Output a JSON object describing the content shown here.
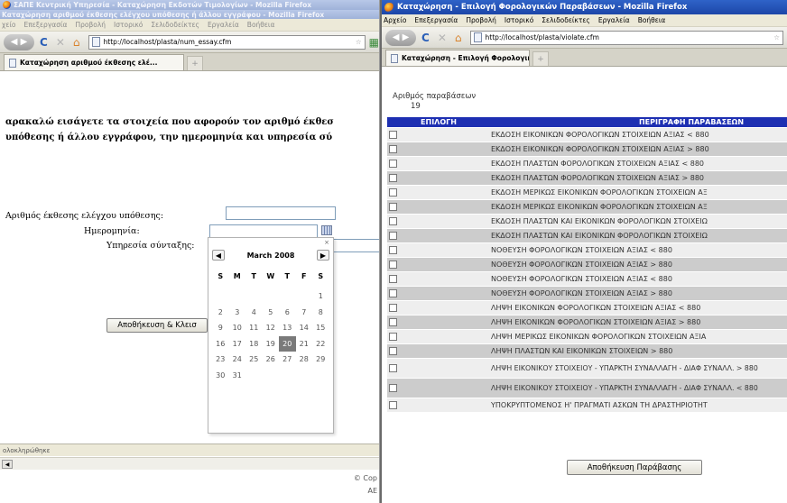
{
  "left_window": {
    "title": "ΣΑΠΕ Κεντρική Υπηρεσία - Καταχώρηση Εκδοτών Τιμολογίων - Mozilla Firefox",
    "title_line2": "Καταχώρηση αριθμού έκθεσης ελέγχου υπόθεσης ή άλλου εγγράφου - Mozilla Firefox",
    "menu": [
      "χείο",
      "Επεξεργασία",
      "Προβολή",
      "Ιστορικό",
      "Σελιδοδείκτες",
      "Εργαλεία",
      "Βοήθεια"
    ],
    "url": "http://localhost/plasta/num_essay.cfm",
    "tab_title": "Καταχώρηση αριθμού έκθεσης ελέ...",
    "instruction_line1": "αρακαλώ εισάγετε τα στοιχεία που αφορούν τον αριθμό έκθεσ",
    "instruction_line2": "υπόθεσης ή άλλου εγγράφου, την ημερομηνία και υπηρεσία σύ",
    "field_report_label": "Αριθμός έκθεσης ελέγχου υπόθεσης:",
    "field_date_label": "Ημερομηνία:",
    "field_service_label": "Υπηρεσία σύνταξης:",
    "save_button": "Αποθήκευση & Κλεισ",
    "status": "ολοκληρώθηκε",
    "copyright_line1": "© Cop",
    "copyright_line2": "ΑΕ",
    "calendar": {
      "close": "×",
      "prev": "◀",
      "next": "▶",
      "month": "March 2008",
      "dow": [
        "S",
        "M",
        "T",
        "W",
        "T",
        "F",
        "S"
      ],
      "days": [
        "",
        "",
        "",
        "",
        "",
        "",
        "1",
        "2",
        "3",
        "4",
        "5",
        "6",
        "7",
        "8",
        "9",
        "10",
        "11",
        "12",
        "13",
        "14",
        "15",
        "16",
        "17",
        "18",
        "19",
        "20",
        "21",
        "22",
        "23",
        "24",
        "25",
        "26",
        "27",
        "28",
        "29",
        "30",
        "31"
      ],
      "selected": "20"
    }
  },
  "right_window": {
    "title": "Καταχώρηση - Επιλογή Φορολογικών Παραβάσεων - Mozilla Firefox",
    "menu": [
      "Αρχείο",
      "Επεξεργασία",
      "Προβολή",
      "Ιστορικό",
      "Σελιδοδείκτες",
      "Εργαλεία",
      "Βοήθεια"
    ],
    "url": "http://localhost/plasta/violate.cfm",
    "tab_title": "Καταχώρηση - Επιλογή Φορολογικώ...",
    "new_tab": "+",
    "count_label": "Αριθμός παραβάσεων",
    "count_value": "19",
    "table": {
      "headers": [
        "ΕΠΙΛΟΓΗ",
        "ΠΕΡΙΓΡΑΦΗ ΠΑΡΑΒΑΣΕΩΝ"
      ],
      "rows": [
        "ΕΚΔΟΣΗ ΕΙΚΟΝΙΚΩΝ ΦΟΡΟΛΟΓΙΚΩΝ ΣΤΟΙΧΕΙΩΝ ΑΞΙΑΣ < 880",
        "ΕΚΔΟΣΗ ΕΙΚΟΝΙΚΩΝ ΦΟΡΟΛΟΓΙΚΩΝ ΣΤΟΙΧΕΙΩΝ ΑΞΙΑΣ > 880",
        "ΕΚΔΟΣΗ ΠΛΑΣΤΩΝ ΦΟΡΟΛΟΓΙΚΩΝ ΣΤΟΙΧΕΙΩΝ ΑΞΙΑΣ < 880",
        "ΕΚΔΟΣΗ ΠΛΑΣΤΩΝ ΦΟΡΟΛΟΓΙΚΩΝ ΣΤΟΙΧΕΙΩΝ ΑΞΙΑΣ > 880",
        "ΕΚΔΟΣΗ ΜΕΡΙΚΩΣ ΕΙΚΟΝΙΚΩΝ ΦΟΡΟΛΟΓΙΚΩΝ ΣΤΟΙΧΕΙΩΝ ΑΞ",
        "ΕΚΔΟΣΗ ΜΕΡΙΚΩΣ ΕΙΚΟΝΙΚΩΝ ΦΟΡΟΛΟΓΙΚΩΝ ΣΤΟΙΧΕΙΩΝ ΑΞ",
        "ΕΚΔΟΣΗ ΠΛΑΣΤΩΝ ΚΑΙ ΕΙΚΟΝΙΚΩΝ ΦΟΡΟΛΟΓΙΚΩΝ ΣΤΟΙΧΕΙΩ",
        "ΕΚΔΟΣΗ ΠΛΑΣΤΩΝ ΚΑΙ ΕΙΚΟΝΙΚΩΝ ΦΟΡΟΛΟΓΙΚΩΝ ΣΤΟΙΧΕΙΩ",
        "ΝΟΘΕΥΣΗ ΦΟΡΟΛΟΓΙΚΩΝ ΣΤΟΙΧΕΙΩΝ ΑΞΙΑΣ < 880",
        "ΝΟΘΕΥΣΗ ΦΟΡΟΛΟΓΙΚΩΝ ΣΤΟΙΧΕΙΩΝ ΑΞΙΑΣ > 880",
        "ΝΟΘΕΥΣΗ ΦΟΡΟΛΟΓΙΚΩΝ ΣΤΟΙΧΕΙΩΝ ΑΞΙΑΣ < 880",
        "ΝΟΘΕΥΣΗ ΦΟΡΟΛΟΓΙΚΩΝ ΣΤΟΙΧΕΙΩΝ ΑΞΙΑΣ > 880",
        "ΛΗΨΗ ΕΙΚΟΝΙΚΩΝ ΦΟΡΟΛΟΓΙΚΩΝ ΣΤΟΙΧΕΙΩΝ ΑΞΙΑΣ < 880",
        "ΛΗΨΗ ΕΙΚΟΝΙΚΩΝ ΦΟΡΟΛΟΓΙΚΩΝ ΣΤΟΙΧΕΙΩΝ ΑΞΙΑΣ > 880",
        "ΛΗΨΗ ΜΕΡΙΚΩΣ ΕΙΚΟΝΙΚΩΝ ΦΟΡΟΛΟΓΙΚΩΝ ΣΤΟΙΧΕΙΩΝ ΑΞΙΑ",
        "ΛΗΨΗ ΠΛΑΣΤΩΝ ΚΑΙ ΕΙΚΟΝΙΚΩΝ ΣΤΟΙΧΕΙΩΝ > 880",
        "ΛΗΨΗ ΕΙΚΟΝΙΚΟΥ ΣΤΟΙΧΕΙΟΥ - ΥΠΑΡΚΤΗ ΣΥΝΑΛΛΑΓΗ - ΔΙΑΦ ΣΥΝΑΛΛ. > 880",
        "ΛΗΨΗ ΕΙΚΟΝΙΚΟΥ ΣΤΟΙΧΕΙΟΥ - ΥΠΑΡΚΤΗ ΣΥΝΑΛΛΑΓΗ - ΔΙΑΦ ΣΥΝΑΛΛ. < 880",
        "ΥΠΟΚΡΥΠΤΟΜΕΝΟΣ Η' ΠΡΑΓΜΑΤΙ ΑΣΚΩΝ ΤΗ ΔΡΑΣΤΗΡΙΟΤΗΤ"
      ]
    },
    "save_button": "Αποθήκευση Παράβασης"
  }
}
